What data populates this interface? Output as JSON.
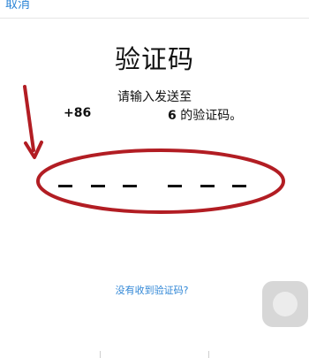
{
  "nav": {
    "cancel_label": "取消"
  },
  "page": {
    "title": "验证码",
    "hint": "请输入发送至",
    "phone_prefix": "+86",
    "phone_tail_digit": "6",
    "phone_tail_text": " 的验证码。"
  },
  "code": {
    "length": 6,
    "entered": ""
  },
  "links": {
    "resend_label": "没有收到验证码?"
  },
  "colors": {
    "accent": "#2f86d6",
    "annotation": "#b21d23"
  }
}
